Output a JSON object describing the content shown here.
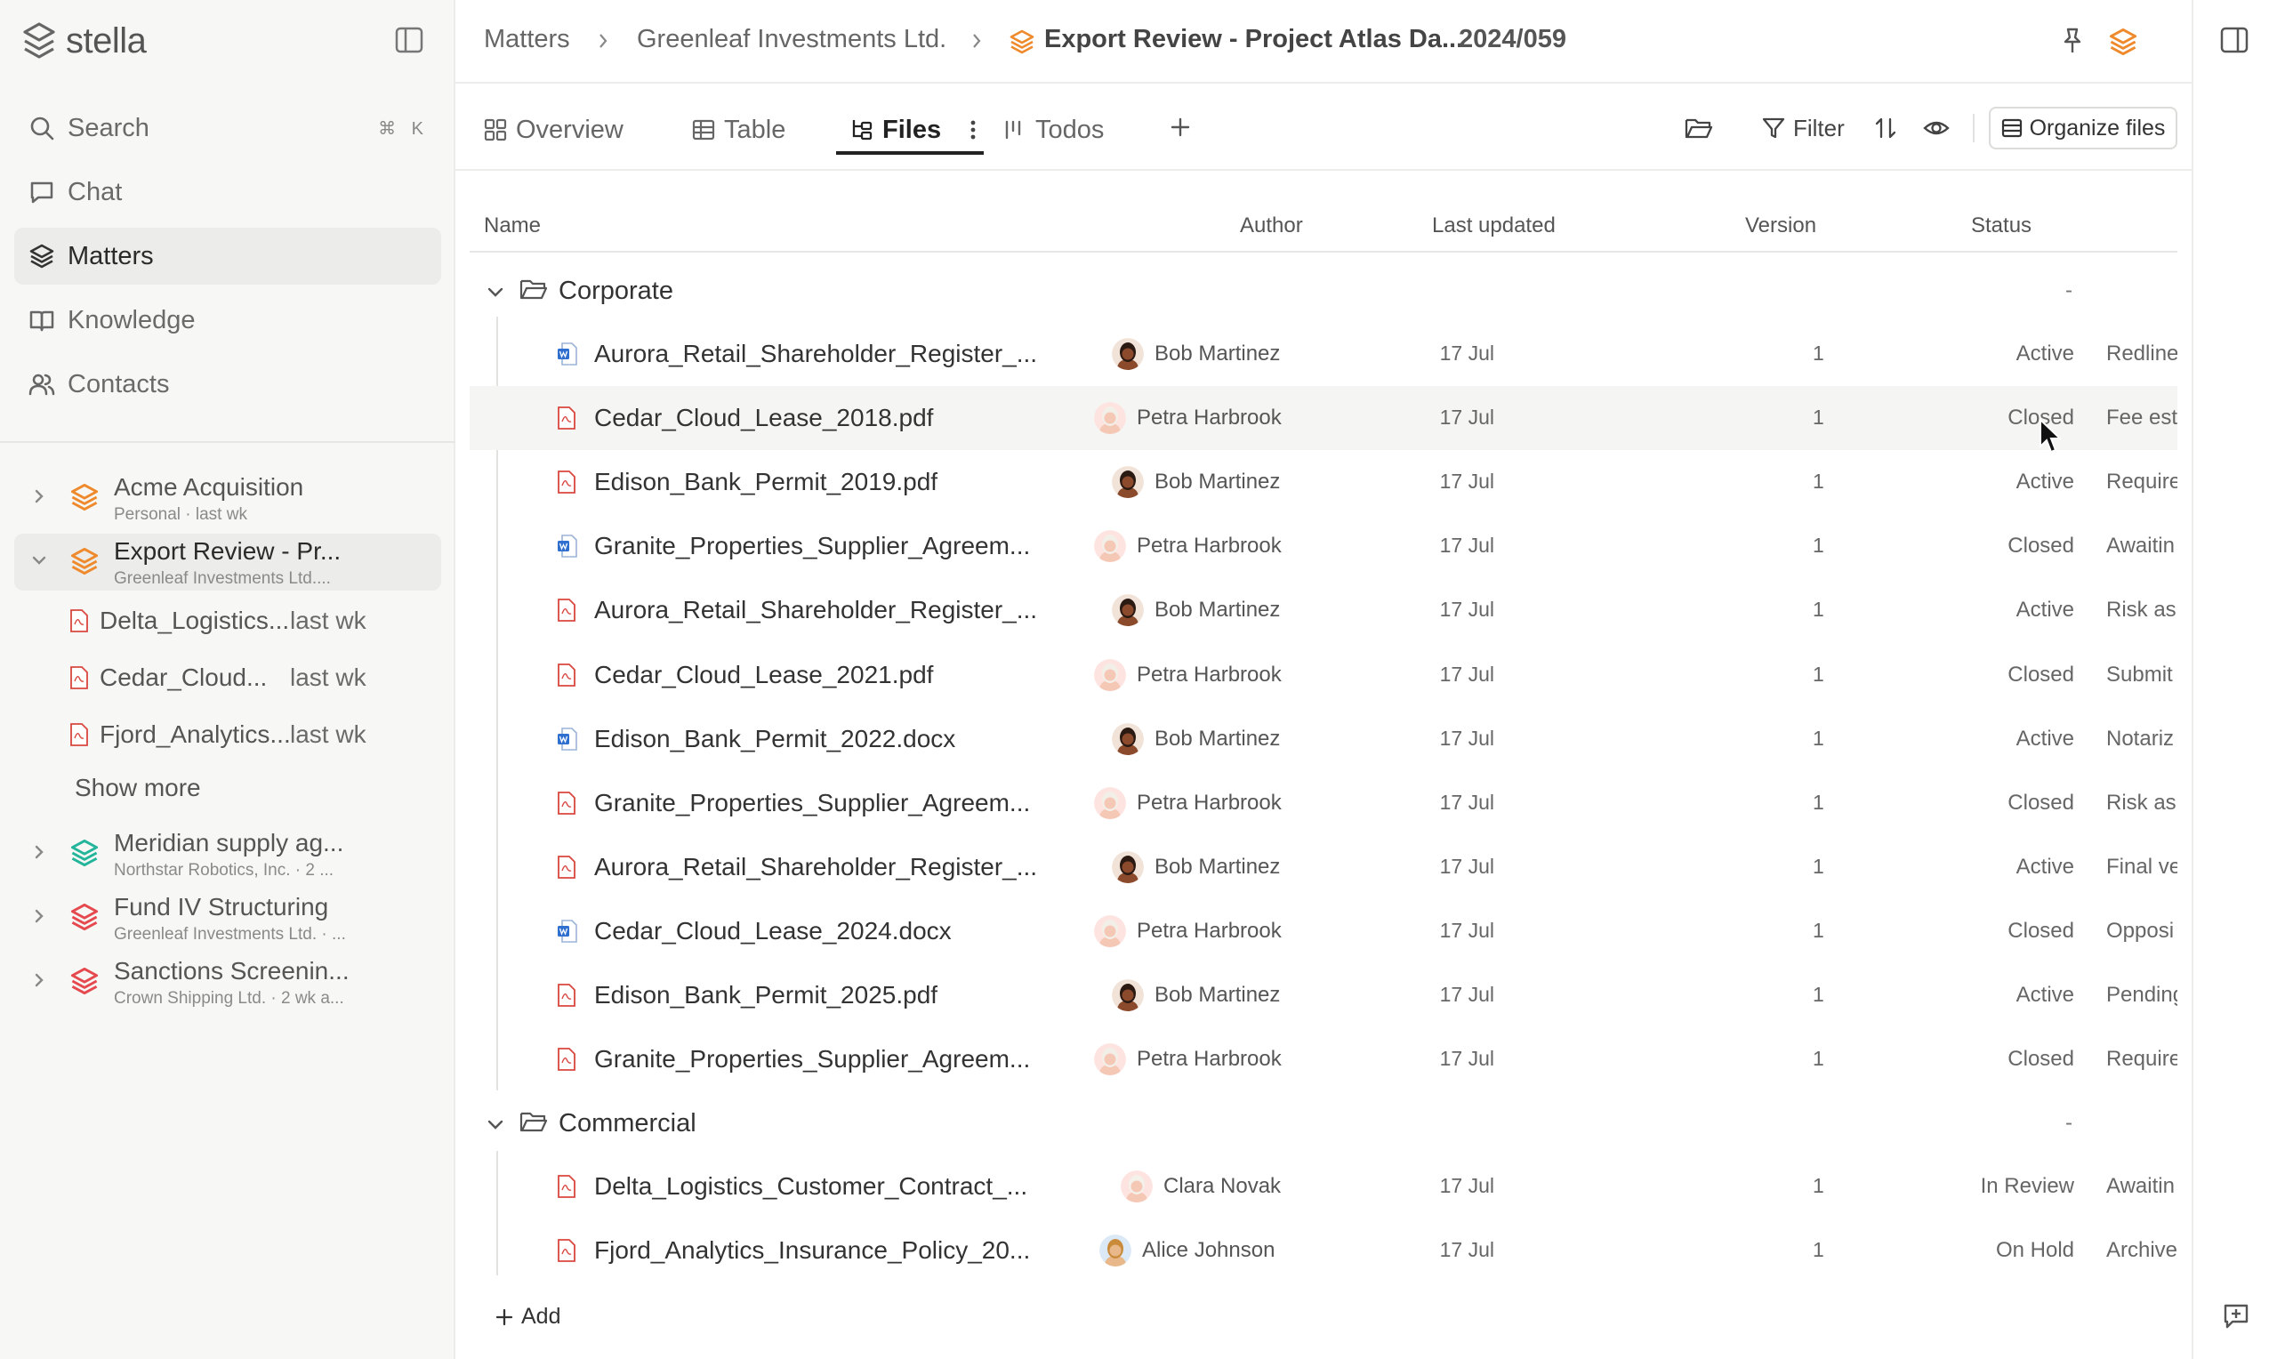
{
  "brand": {
    "name": "stella"
  },
  "nav": {
    "search": "Search",
    "search_shortcut": "⌘ K",
    "chat": "Chat",
    "matters": "Matters",
    "knowledge": "Knowledge",
    "contacts": "Contacts"
  },
  "sidebar_matters": [
    {
      "title": "Acme Acquisition",
      "subtitle": "Personal · last wk"
    },
    {
      "title": "Export Review - Pr...",
      "subtitle": "Greenleaf Investments Ltd...."
    },
    {
      "title": "Meridian supply ag...",
      "subtitle": "Northstar Robotics, Inc. · 2 ..."
    },
    {
      "title": "Fund IV Structuring",
      "subtitle": "Greenleaf Investments Ltd. · ..."
    },
    {
      "title": "Sanctions Screenin...",
      "subtitle": "Crown Shipping Ltd. · 2 wk a..."
    }
  ],
  "sidebar_files": [
    {
      "name": "Delta_Logistics...",
      "time": "last wk"
    },
    {
      "name": "Cedar_Cloud...",
      "time": "last wk"
    },
    {
      "name": "Fjord_Analytics...",
      "time": "last wk"
    }
  ],
  "show_more": "Show more",
  "breadcrumb": {
    "root": "Matters",
    "client": "Greenleaf Investments Ltd.",
    "matter": "Export Review - Project Atlas Da...",
    "ref": "2024/059"
  },
  "tabs": {
    "overview": "Overview",
    "table": "Table",
    "files": "Files",
    "todos": "Todos"
  },
  "toolbar": {
    "filter": "Filter",
    "organize": "Organize files"
  },
  "columns": {
    "name": "Name",
    "author": "Author",
    "updated": "Last updated",
    "version": "Version",
    "status": "Status"
  },
  "groups": [
    {
      "name": "Corporate",
      "dash": "-",
      "files": [
        {
          "type": "docx",
          "name": "Aurora_Retail_Shareholder_Register_...",
          "author": "Bob Martinez",
          "updated": "17 Jul",
          "version": "1",
          "status": "Active",
          "note": "Redline"
        },
        {
          "type": "pdf",
          "name": "Cedar_Cloud_Lease_2018.pdf",
          "author": "Petra Harbrook",
          "updated": "17 Jul",
          "version": "1",
          "status": "Closed",
          "note": "Fee est"
        },
        {
          "type": "pdf",
          "name": "Edison_Bank_Permit_2019.pdf",
          "author": "Bob Martinez",
          "updated": "17 Jul",
          "version": "1",
          "status": "Active",
          "note": "Require"
        },
        {
          "type": "docx",
          "name": "Granite_Properties_Supplier_Agreem...",
          "author": "Petra Harbrook",
          "updated": "17 Jul",
          "version": "1",
          "status": "Closed",
          "note": "Awaitin"
        },
        {
          "type": "pdf",
          "name": "Aurora_Retail_Shareholder_Register_...",
          "author": "Bob Martinez",
          "updated": "17 Jul",
          "version": "1",
          "status": "Active",
          "note": "Risk as:"
        },
        {
          "type": "pdf",
          "name": "Cedar_Cloud_Lease_2021.pdf",
          "author": "Petra Harbrook",
          "updated": "17 Jul",
          "version": "1",
          "status": "Closed",
          "note": "Submit"
        },
        {
          "type": "docx",
          "name": "Edison_Bank_Permit_2022.docx",
          "author": "Bob Martinez",
          "updated": "17 Jul",
          "version": "1",
          "status": "Active",
          "note": "Notariz"
        },
        {
          "type": "pdf",
          "name": "Granite_Properties_Supplier_Agreem...",
          "author": "Petra Harbrook",
          "updated": "17 Jul",
          "version": "1",
          "status": "Closed",
          "note": "Risk as:"
        },
        {
          "type": "pdf",
          "name": "Aurora_Retail_Shareholder_Register_...",
          "author": "Bob Martinez",
          "updated": "17 Jul",
          "version": "1",
          "status": "Active",
          "note": "Final ve"
        },
        {
          "type": "docx",
          "name": "Cedar_Cloud_Lease_2024.docx",
          "author": "Petra Harbrook",
          "updated": "17 Jul",
          "version": "1",
          "status": "Closed",
          "note": "Opposi"
        },
        {
          "type": "pdf",
          "name": "Edison_Bank_Permit_2025.pdf",
          "author": "Bob Martinez",
          "updated": "17 Jul",
          "version": "1",
          "status": "Active",
          "note": "Pending"
        },
        {
          "type": "pdf",
          "name": "Granite_Properties_Supplier_Agreem...",
          "author": "Petra Harbrook",
          "updated": "17 Jul",
          "version": "1",
          "status": "Closed",
          "note": "Require"
        }
      ]
    },
    {
      "name": "Commercial",
      "dash": "-",
      "files": [
        {
          "type": "pdf",
          "name": "Delta_Logistics_Customer_Contract_...",
          "author": "Clara Novak",
          "updated": "17 Jul",
          "version": "1",
          "status": "In Review",
          "note": "Awaitin"
        },
        {
          "type": "pdf",
          "name": "Fjord_Analytics_Insurance_Policy_20...",
          "author": "Alice Johnson",
          "updated": "17 Jul",
          "version": "1",
          "status": "On Hold",
          "note": "Archive"
        }
      ]
    }
  ],
  "add_label": "Add",
  "colors": {
    "orange": "#ee8a2c",
    "teal": "#22b59a",
    "red": "#e5484d",
    "pdf_red": "#d9473f",
    "word_blue": "#2f6fd0"
  }
}
